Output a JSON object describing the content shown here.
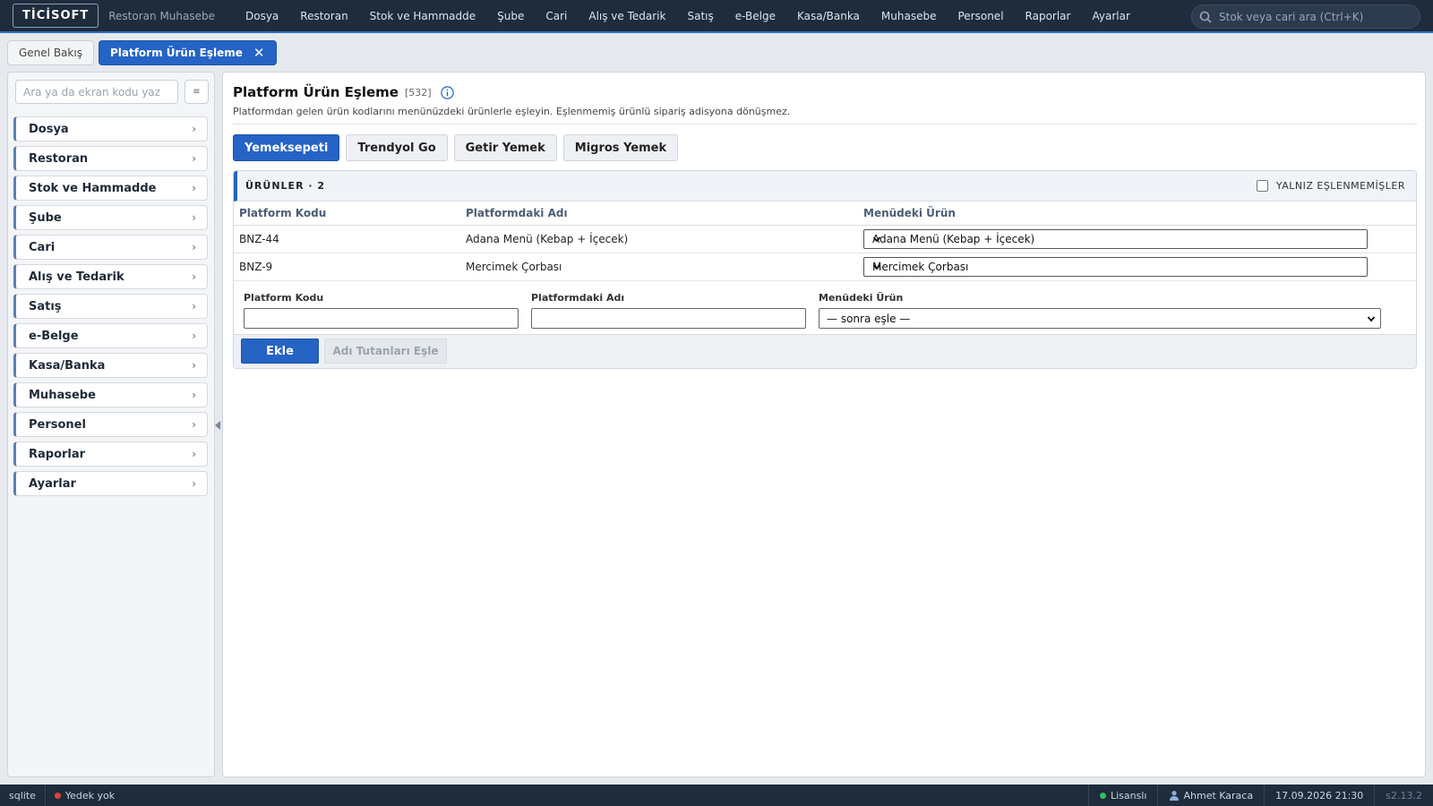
{
  "topbar": {
    "logo": "TİCİSOFT",
    "subtitle": "Restoran Muhasebe",
    "menu": [
      "Dosya",
      "Restoran",
      "Stok ve Hammadde",
      "Şube",
      "Cari",
      "Alış ve Tedarik",
      "Satış",
      "e-Belge",
      "Kasa/Banka",
      "Muhasebe",
      "Personel",
      "Raporlar",
      "Ayarlar"
    ],
    "search_placeholder": "Stok veya cari ara (Ctrl+K)"
  },
  "tabs": [
    {
      "label": "Genel Bakış",
      "active": false
    },
    {
      "label": "Platform Ürün Eşleme",
      "active": true,
      "close": "✕"
    }
  ],
  "sidebar": {
    "search_placeholder": "Ara ya da ekran kodu yaz",
    "button_glyph": "≡",
    "items": [
      "Dosya",
      "Restoran",
      "Stok ve Hammadde",
      "Şube",
      "Cari",
      "Alış ve Tedarik",
      "Satış",
      "e-Belge",
      "Kasa/Banka",
      "Muhasebe",
      "Personel",
      "Raporlar",
      "Ayarlar"
    ],
    "chevron": "›"
  },
  "page": {
    "title": "Platform Ürün Eşleme",
    "code": "[532]",
    "description": "Platformdan gelen ürün kodlarını menünüzdeki ürünlerle eşleyin. Eşlenmemiş ürünlü sipariş adisyona dönüşmez.",
    "platform_tabs": [
      {
        "label": "Yemeksepeti",
        "active": true
      },
      {
        "label": "Trendyol Go",
        "active": false
      },
      {
        "label": "Getir Yemek",
        "active": false
      },
      {
        "label": "Migros Yemek",
        "active": false
      }
    ]
  },
  "products": {
    "title": "ÜRÜNLER · 2",
    "only_unmatched_label": "YALNIZ EŞLENMEMİŞLER",
    "only_unmatched_checked": false,
    "columns": [
      "Platform Kodu",
      "Platformdaki Adı",
      "Menüdeki Ürün"
    ],
    "rows": [
      {
        "code": "BNZ-44",
        "name": "Adana Menü (Kebap + İçecek)",
        "menu_product": "Adana Menü (Kebap + İçecek)"
      },
      {
        "code": "BNZ-9",
        "name": "Mercimek Çorbası",
        "menu_product": "Mercimek Çorbası"
      }
    ]
  },
  "add_form": {
    "code_label": "Platform Kodu",
    "code_value": "",
    "name_label": "Platformdaki Adı",
    "name_value": "",
    "menu_label": "Menüdeki Ürün",
    "menu_value": "— sonra eşle —",
    "add_button": "Ekle",
    "match_button": "Adı Tutanları Eşle"
  },
  "statusbar": {
    "db": "sqlite",
    "backup": "Yedek yok",
    "license": "Lisanslı",
    "user": "Ahmet Karaca",
    "datetime": "17.09.2026 21:30",
    "version": "s2.13.2"
  },
  "colors": {
    "accent": "#2563c4",
    "topbar": "#1e2c3c",
    "backup_dot": "#e0413a",
    "license_dot": "#2fbf5a"
  }
}
